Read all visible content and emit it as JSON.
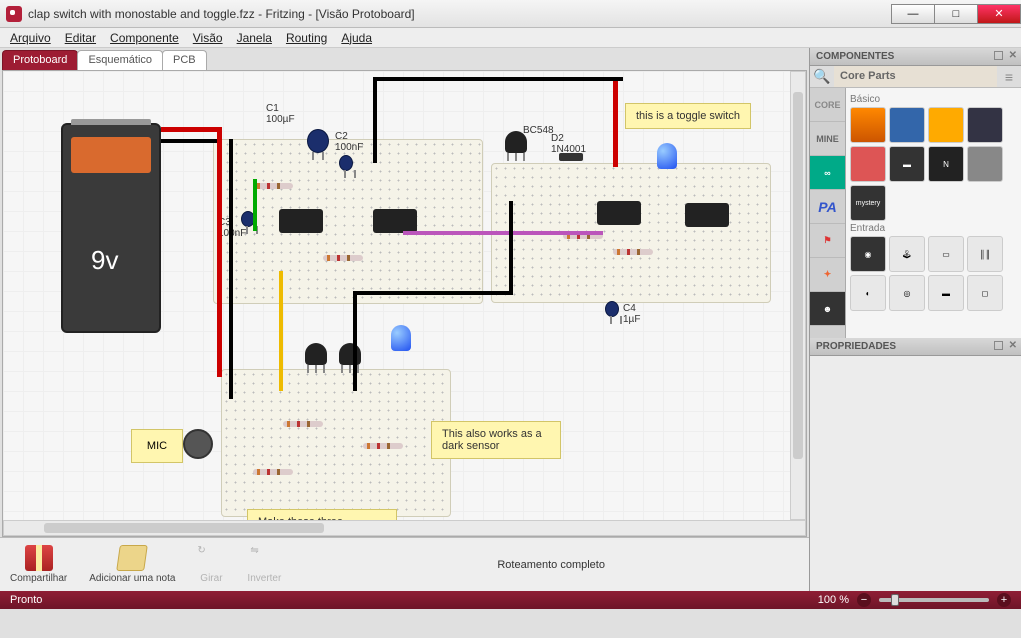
{
  "window": {
    "title": "clap switch with monostable and toggle.fzz - Fritzing - [Visão Protoboard]"
  },
  "menu": {
    "arquivo": "Arquivo",
    "editar": "Editar",
    "componente": "Componente",
    "visao": "Visão",
    "janela": "Janela",
    "routing": "Routing",
    "ajuda": "Ajuda"
  },
  "tabs": {
    "protoboard": "Protoboard",
    "esquematico": "Esquemático",
    "pcb": "PCB"
  },
  "battery": {
    "label": "9v"
  },
  "components": {
    "c1": "C1\n100µF",
    "c2": "C2\n100nF",
    "c3": "C3\n100nF",
    "c4": "C4\n1µF",
    "bc548": "BC548",
    "d2": "D2\n1N4001",
    "mic": "MIC"
  },
  "notes": {
    "toggle": "this is a toggle switch",
    "dark": "This also works as a dark sensor",
    "combine": "Make these three modules separately and combine them to"
  },
  "bottom": {
    "compartilhar": "Compartilhar",
    "adicionar": "Adicionar uma nota",
    "girar": "Girar",
    "inverter": "Inverter",
    "routing": "Roteamento completo"
  },
  "side": {
    "componentes_hdr": "COMPONENTES",
    "core_parts": "Core Parts",
    "propriedades_hdr": "PROPRIEDADES",
    "tabs": {
      "core": "CORE",
      "mine": "MINE"
    },
    "groups": {
      "basico": "Básico",
      "entrada": "Entrada"
    },
    "mystery": "mystery"
  },
  "status": {
    "pronto": "Pronto",
    "zoom": "100 %"
  }
}
